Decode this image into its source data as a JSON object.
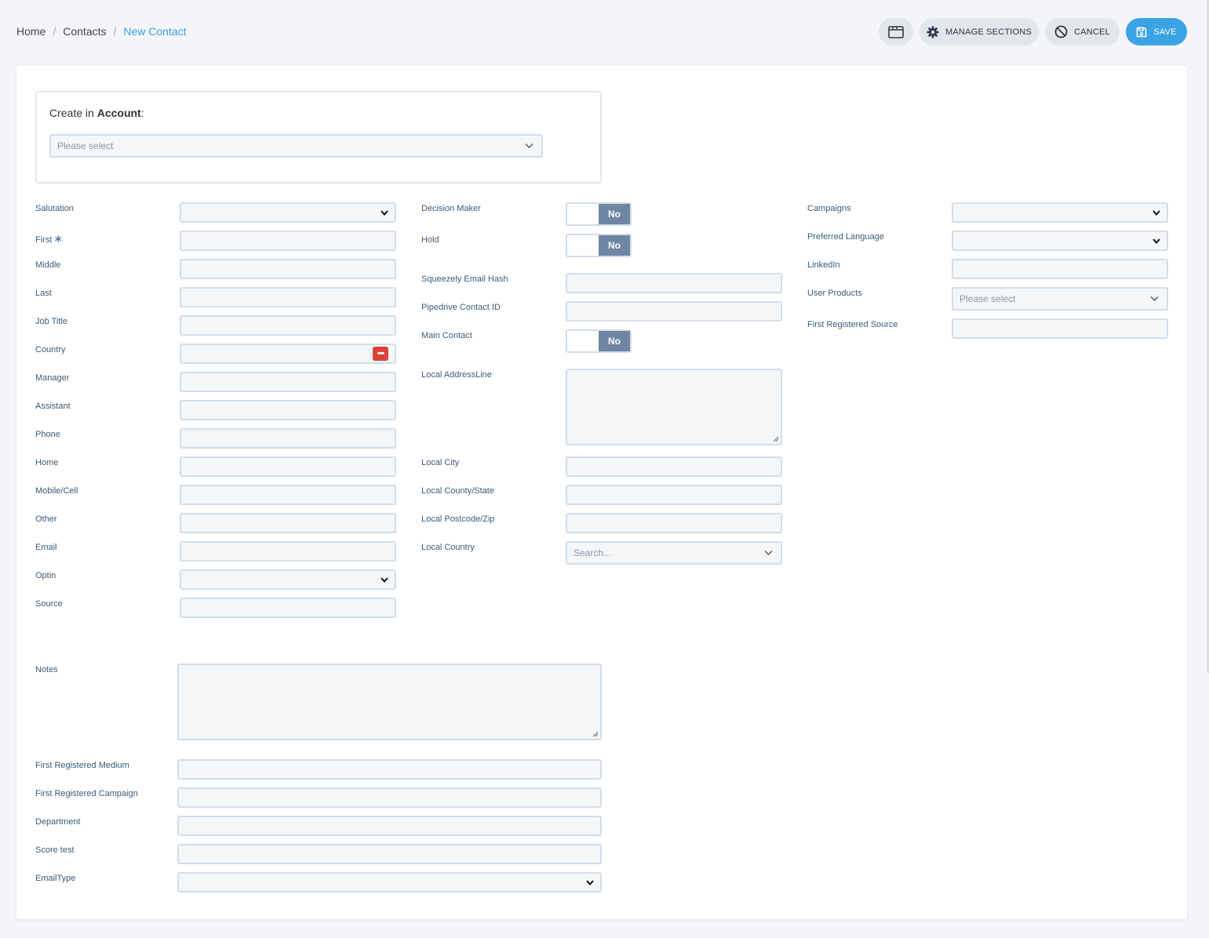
{
  "breadcrumb": {
    "home": "Home",
    "contacts": "Contacts",
    "current": "New Contact"
  },
  "toolbar": {
    "manage_label": "MANAGE SECTIONS",
    "cancel_label": "CANCEL",
    "save_label": "SAVE"
  },
  "account": {
    "prefix": "Create in ",
    "bold": "Account",
    "suffix": ":",
    "placeholder": "Please select"
  },
  "col1": {
    "salutation": "Salutation",
    "first": "First",
    "required_mark": "∗",
    "middle": "Middle",
    "last": "Last",
    "job_title": "Job Title",
    "country": "Country",
    "country_btn": "•••",
    "manager": "Manager",
    "assistant": "Assistant",
    "phone": "Phone",
    "home": "Home",
    "mobile": "Mobile/Cell",
    "other": "Other",
    "email": "Email",
    "optin": "Optin",
    "source": "Source"
  },
  "col2": {
    "decision_maker": "Decision Maker",
    "hold": "Hold",
    "squeezely": "Squeezely Email Hash",
    "pipedrive": "Pipedrive Contact ID",
    "main_contact": "Main Contact",
    "address": "Local AddressLine",
    "city": "Local City",
    "county": "Local County/State",
    "postcode": "Local Postcode/Zip",
    "country": "Local Country",
    "country_placeholder": "Search...",
    "toggle_value": "No"
  },
  "col3": {
    "campaigns": "Campaigns",
    "language": "Preferred Language",
    "linkedin": "LinkedIn",
    "user_products": "User Products",
    "user_products_placeholder": "Please select",
    "first_source": "First Registered Source"
  },
  "bottom": {
    "notes": "Notes",
    "medium": "First Registered Medium",
    "campaign": "First Registered Campaign",
    "department": "Department",
    "score": "Score test",
    "email_type": "EmailType"
  },
  "colors": {
    "accent": "#3aa3e3",
    "toggle": "#6e86a3",
    "danger": "#d9443a"
  }
}
